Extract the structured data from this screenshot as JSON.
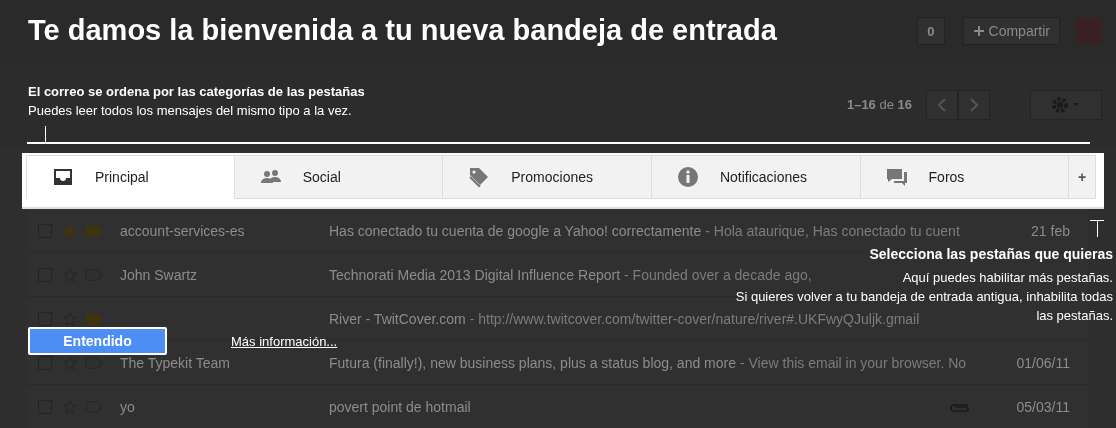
{
  "top_bar": {
    "count_button": "0",
    "share_button": "Compartir"
  },
  "welcome": {
    "title": "Te damos la bienvenida a tu nueva bandeja de entrada",
    "heading": "El correo se ordena por las categorías de las pestañas",
    "text": "Puedes leer todos los mensajes del mismo tipo a la vez."
  },
  "pagination": {
    "range": "1–16",
    "of": "de",
    "total": "16"
  },
  "tabs": [
    {
      "label": "Principal",
      "kind": "inbox",
      "selected": true
    },
    {
      "label": "Social",
      "kind": "people",
      "selected": false
    },
    {
      "label": "Promociones",
      "kind": "tag",
      "selected": false
    },
    {
      "label": "Notificaciones",
      "kind": "info",
      "selected": false
    },
    {
      "label": "Foros",
      "kind": "chat",
      "selected": false
    }
  ],
  "add_tab": "+",
  "messages": [
    {
      "sender": "account-services-es",
      "subject": "Has conectado tu cuenta de google a Yahoo! correctamente",
      "snippet": "- Hola ataurique, Has conectado tu cuent",
      "date": "21 feb",
      "checked": false,
      "starred": true,
      "important": true,
      "attachment": false
    },
    {
      "sender": "John Swartz",
      "subject": "Technorati Media 2013 Digital Influence Report",
      "snippet": "- Founded over a decade ago,",
      "checked": false,
      "starred": false,
      "important": false,
      "attachment": false
    },
    {
      "subject": "River - TwitCover.com",
      "snippet": "- http://www.twitcover.com/twitter-cover/nature/river#.UKFwyQJuljk.gmail",
      "checked": false,
      "starred": false,
      "important": true,
      "attachment": false
    },
    {
      "sender": "The Typekit Team",
      "subject": "Futura (finally!), new business plans, plus a status blog, and more",
      "snippet": "- View this email in your browser. No",
      "date": "01/06/11",
      "checked": false,
      "starred": false,
      "important": false,
      "attachment": false
    },
    {
      "sender": "yo",
      "subject": "povert point de hotmail",
      "date": "05/03/11",
      "checked": false,
      "starred": false,
      "important": false,
      "attachment": true
    }
  ],
  "tip": {
    "heading": "Selecciona las pestañas que quieras",
    "lines": [
      "Aquí puedes habilitar más pestañas.",
      "Si quieres volver a tu bandeja de entrada antigua, inhabilita todas",
      "las pestañas."
    ]
  },
  "actions": {
    "confirm": "Entendido",
    "more_info": "Más información..."
  }
}
